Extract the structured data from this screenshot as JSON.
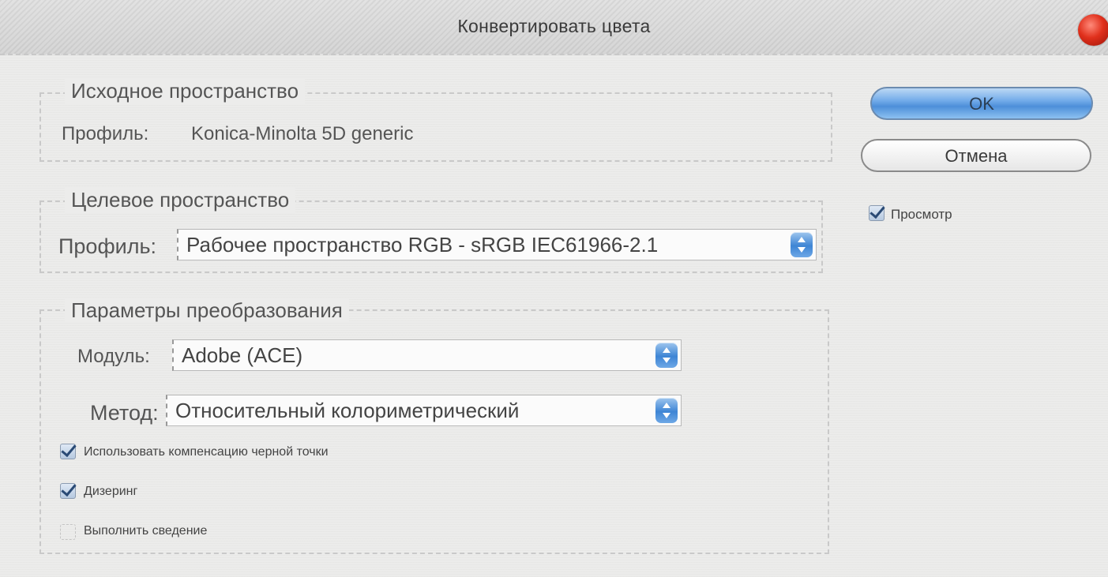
{
  "window": {
    "title": "Конвертировать цвета",
    "close_icon": "close-icon"
  },
  "source": {
    "legend": "Исходное пространство",
    "profile_label": "Профиль:",
    "profile_value": "Konica-Minolta 5D generic"
  },
  "target": {
    "legend": "Целевое пространство",
    "profile_label": "Профиль:",
    "profile_value": "Рабочее пространство RGB - sRGB IEC61966-2.1"
  },
  "conversion": {
    "legend": "Параметры преобразования",
    "engine_label": "Модуль:",
    "engine_value": "Adobe (ACE)",
    "intent_label": "Метод:",
    "intent_value": "Относительный колориметрический",
    "options": [
      {
        "label": "Использовать компенсацию черной точки",
        "checked": true
      },
      {
        "label": "Дизеринг",
        "checked": true
      },
      {
        "label": "Выполнить сведение",
        "checked": false
      }
    ]
  },
  "buttons": {
    "ok": "OK",
    "cancel": "Отмена"
  },
  "preview": {
    "label": "Просмотр",
    "checked": true
  },
  "colors": {
    "accent": "#4d8fd9",
    "close": "#e0301c"
  }
}
